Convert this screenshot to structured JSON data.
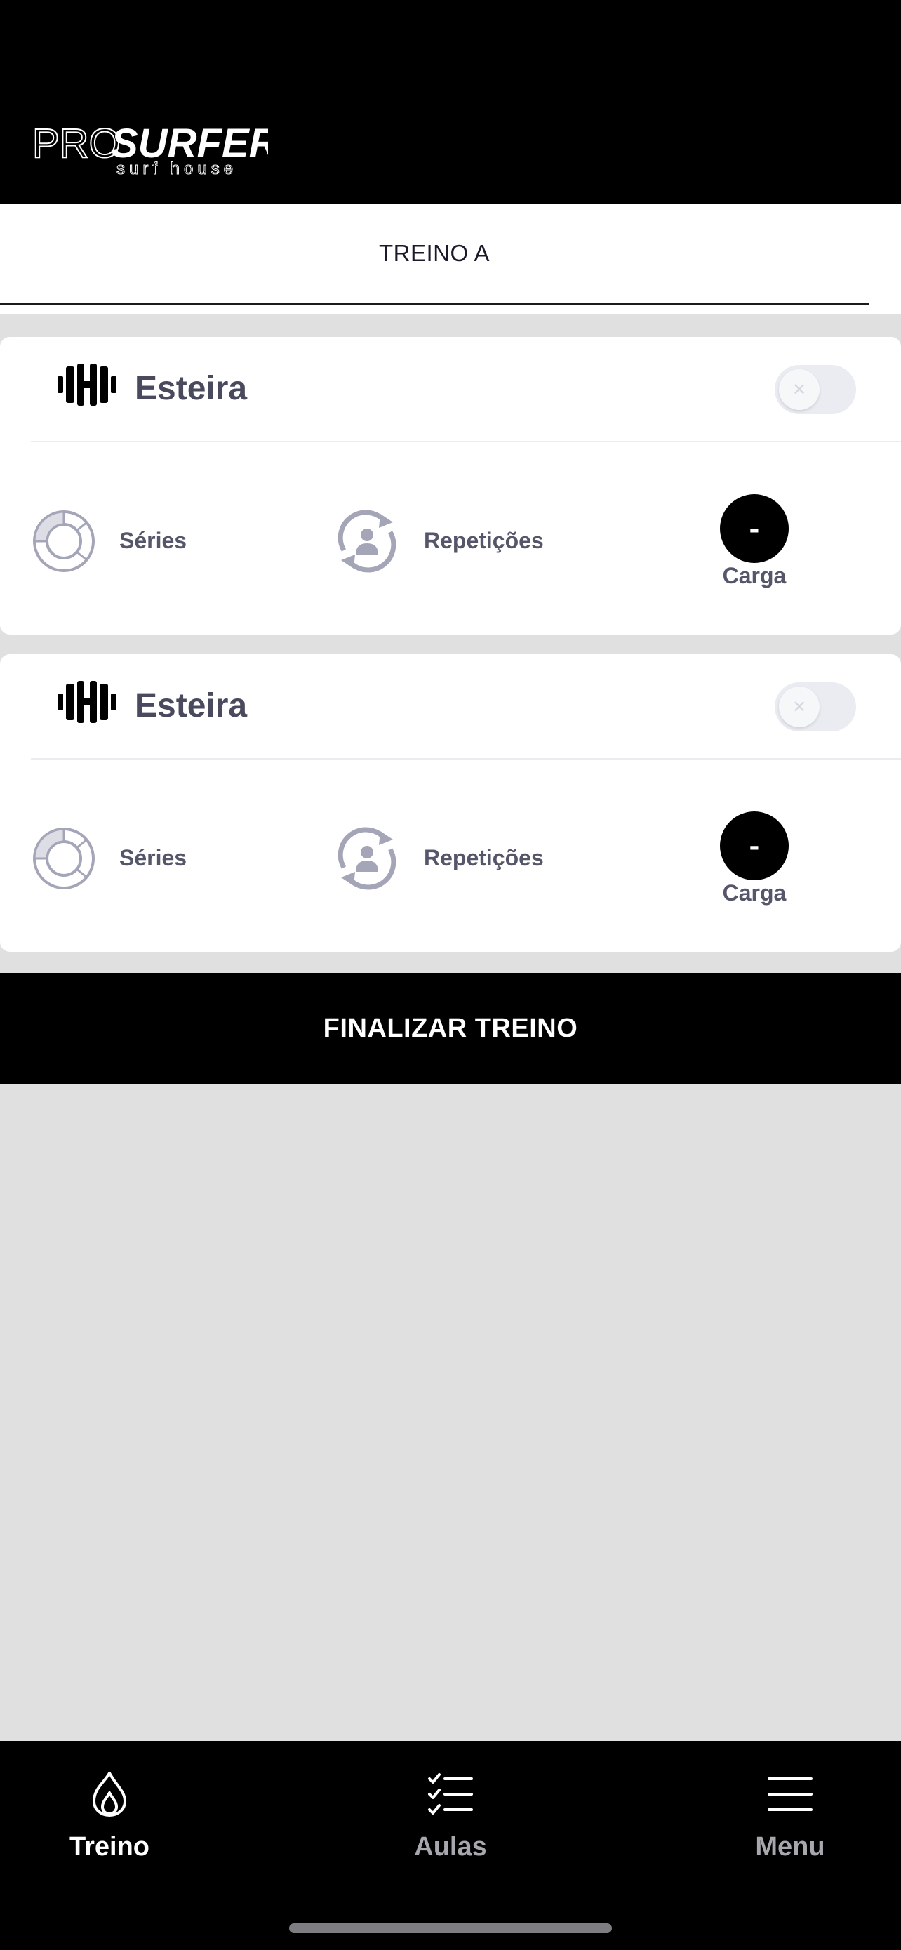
{
  "header": {
    "logo_pro": "PRO",
    "logo_surfer": "SURFER",
    "logo_sub": "surf house"
  },
  "tabs": [
    {
      "label": "TREINO A",
      "active": true
    }
  ],
  "exercises": [
    {
      "name": "Esteira",
      "toggle_on": false,
      "series_label": "Séries",
      "reps_label": "Repetições",
      "carga_value": "-",
      "carga_label": "Carga"
    },
    {
      "name": "Esteira",
      "toggle_on": false,
      "series_label": "Séries",
      "reps_label": "Repetições",
      "carga_value": "-",
      "carga_label": "Carga"
    }
  ],
  "finish_button": {
    "label": "FINALIZAR TREINO"
  },
  "bottom_nav": [
    {
      "label": "Treino",
      "icon": "flame-icon",
      "active": true
    },
    {
      "label": "Aulas",
      "icon": "checklist-icon",
      "active": false
    },
    {
      "label": "Menu",
      "icon": "hamburger-icon",
      "active": false
    }
  ],
  "colors": {
    "background": "#e0e0e0",
    "header": "#000000",
    "card": "#ffffff",
    "text": "#4a4a5e",
    "icon_gray": "#a4a6b8",
    "toggle_track": "#eaecf2"
  }
}
